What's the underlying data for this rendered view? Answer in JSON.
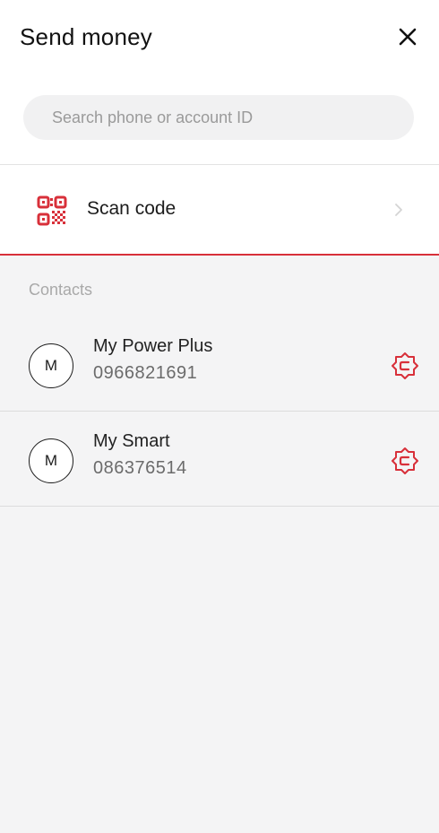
{
  "header": {
    "title": "Send money",
    "close_icon": "close-icon"
  },
  "search": {
    "placeholder": "Search phone or account ID",
    "value": ""
  },
  "scan": {
    "label": "Scan code",
    "icon": "qr-code-icon",
    "chevron": "chevron-right-icon"
  },
  "contacts": {
    "section_title": "Contacts",
    "items": [
      {
        "initial": "M",
        "name": "My Power Plus",
        "number": "0966821691",
        "badge_icon": "cellcard-badge-icon"
      },
      {
        "initial": "M",
        "name": "My Smart",
        "number": "086376514",
        "badge_icon": "cellcard-badge-icon"
      }
    ]
  },
  "colors": {
    "accent": "#d8303a",
    "background": "#f4f4f5",
    "surface": "#ffffff"
  }
}
